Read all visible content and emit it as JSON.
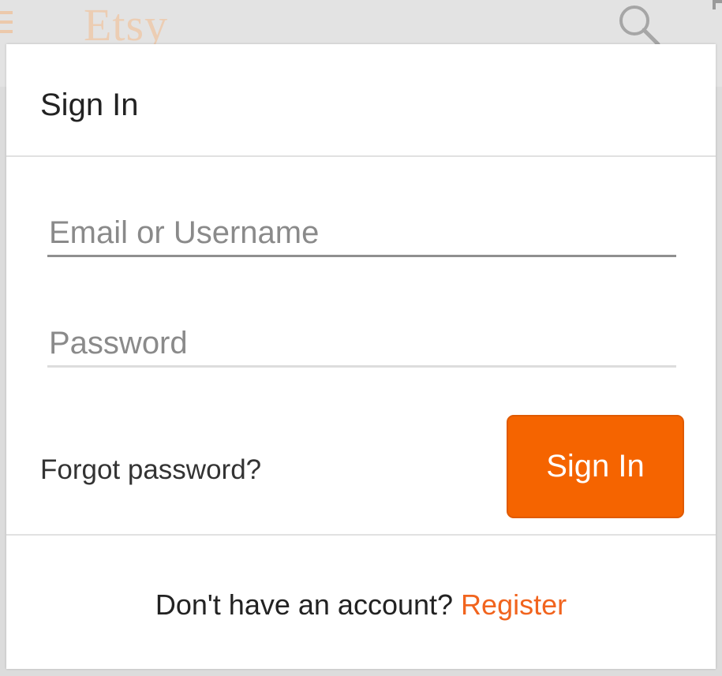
{
  "background": {
    "logo_text": "Etsy",
    "menu_icon": "hamburger-menu-icon",
    "search_icon": "search-icon",
    "cart_icon": "cart-icon"
  },
  "modal": {
    "title": "Sign In",
    "email_field": {
      "value": "",
      "placeholder": "Email or Username"
    },
    "password_field": {
      "value": "",
      "placeholder": "Password"
    },
    "forgot_password_label": "Forgot password?",
    "sign_in_button_label": "Sign In",
    "footer_prompt": "Don't have an account?",
    "register_label": "Register"
  },
  "colors": {
    "accent": "#f56400",
    "register_link": "#f1641e",
    "text": "#222222",
    "divider": "#e1e1e1",
    "overlay": "#dcdcdc"
  }
}
